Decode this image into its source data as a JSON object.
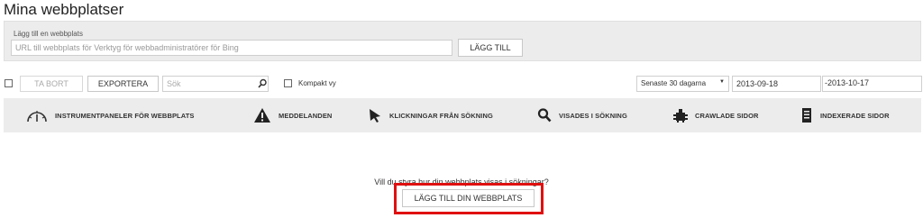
{
  "page_title": "Mina webbplatser",
  "add_site": {
    "label": "Lägg till en webbplats",
    "url_placeholder": "URL till webbplats för Verktyg för webbadministratörer för Bing",
    "url_value": "",
    "add_button": "LÄGG TILL"
  },
  "toolbar": {
    "delete_button": "TA BORT",
    "export_button": "EXPORTERA",
    "search_placeholder": "Sök",
    "compact_view_label": "Kompakt vy",
    "date_range_select": "Senaste 30 dagarna",
    "date_from": "2013-09-18",
    "date_separator": "-",
    "date_to": "2013-10-17"
  },
  "nav": [
    {
      "label": "INSTRUMENTPANELER FÖR WEBBPLATS",
      "icon": "dashboard-icon"
    },
    {
      "label": "MEDDELANDEN",
      "icon": "warning-icon"
    },
    {
      "label": "KLICKNINGAR FRÅN SÖKNING",
      "icon": "cursor-icon"
    },
    {
      "label": "VISADES I SÖKNING",
      "icon": "magnifier-icon"
    },
    {
      "label": "CRAWLADE SIDOR",
      "icon": "crawler-icon"
    },
    {
      "label": "INDEXERADE SIDOR",
      "icon": "document-icon"
    }
  ],
  "empty_state": {
    "prompt": "Vill du styra hur din webbplats visas i sökningar?",
    "cta_button": "LÄGG TILL DIN WEBBPLATS",
    "highlight_color": "#e01010"
  }
}
